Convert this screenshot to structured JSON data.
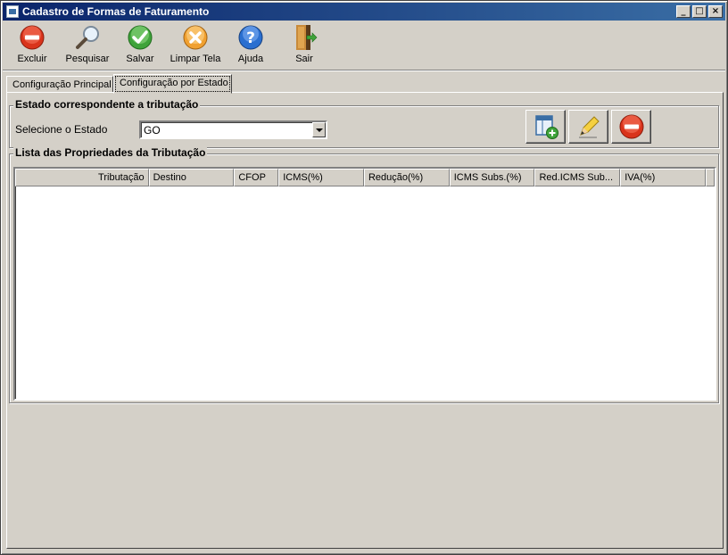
{
  "window": {
    "title": "Cadastro de Formas de Faturamento"
  },
  "toolbar": {
    "items": [
      {
        "label": "Excluir",
        "icon": "delete-icon"
      },
      {
        "label": "Pesquisar",
        "icon": "magnifier-icon"
      },
      {
        "label": "Salvar",
        "icon": "check-icon"
      },
      {
        "label": "Limpar Tela",
        "icon": "clear-icon"
      },
      {
        "label": "Ajuda",
        "icon": "help-icon"
      },
      {
        "label": "Sair",
        "icon": "exit-door-icon"
      }
    ]
  },
  "tabs": [
    {
      "label": "Configuração Principal",
      "active": false
    },
    {
      "label": "Configuração por Estado",
      "active": true
    }
  ],
  "estado_group": {
    "title": "Estado correspondente a tributação",
    "label": "Selecione o Estado",
    "selected": "GO"
  },
  "lista_group": {
    "title": "Lista das Propriedades da Tributação",
    "columns": [
      "Tributação",
      "Destino",
      "CFOP",
      "ICMS(%)",
      "Redução(%)",
      "ICMS Subs.(%)",
      "Red.ICMS Sub...",
      "IVA(%)"
    ],
    "rows": []
  },
  "colors": {
    "titlebar_start": "#0a246a",
    "titlebar_end": "#3a6ea5",
    "face": "#d4d0c8",
    "delete_red": "#d9341c",
    "check_green": "#3fa33a",
    "clear_orange": "#f0a030",
    "help_blue": "#2a6fd0"
  }
}
